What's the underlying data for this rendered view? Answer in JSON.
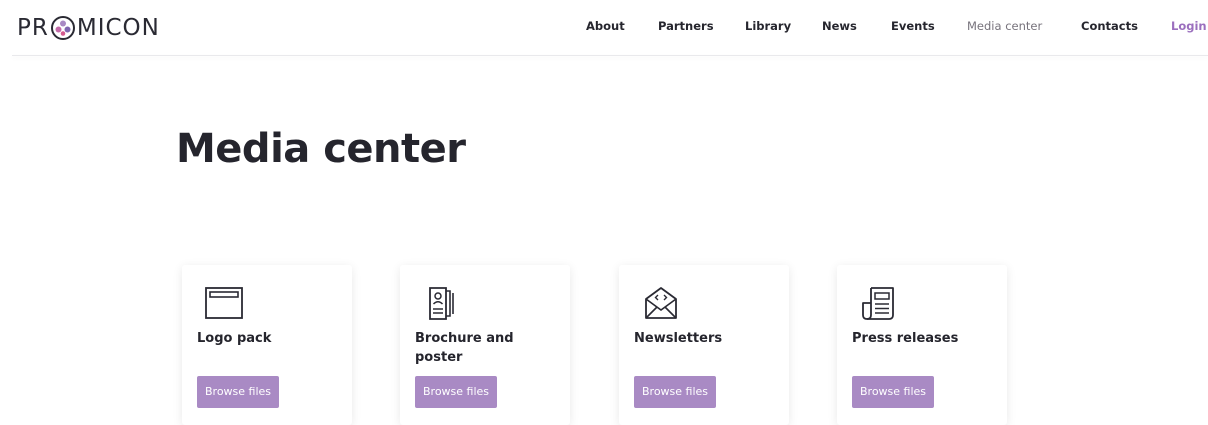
{
  "brand": {
    "name_left": "PR",
    "name_right": "MICON",
    "accent": "#a98ac4",
    "logo_icon": "promicon-circle-logo"
  },
  "nav": {
    "items": [
      {
        "label": "About"
      },
      {
        "label": "Partners"
      },
      {
        "label": "Library"
      },
      {
        "label": "News"
      },
      {
        "label": "Events"
      },
      {
        "label": "Media center",
        "active": true
      },
      {
        "label": "Contacts"
      }
    ],
    "login_label": "Login"
  },
  "page": {
    "title": "Media center"
  },
  "cards": [
    {
      "title": "Logo pack",
      "icon": "browser-window-icon",
      "button": "Browse files"
    },
    {
      "title": "Brochure and poster",
      "icon": "brochure-icon",
      "button": "Browse files"
    },
    {
      "title": "Newsletters",
      "icon": "envelope-code-icon",
      "button": "Browse files"
    },
    {
      "title": "Press releases",
      "icon": "newspaper-icon",
      "button": "Browse files"
    }
  ],
  "colors": {
    "text_dark": "#25252d",
    "nav_active": "#77737c",
    "login": "#9b6fbe",
    "button_bg": "#a98ac4"
  }
}
